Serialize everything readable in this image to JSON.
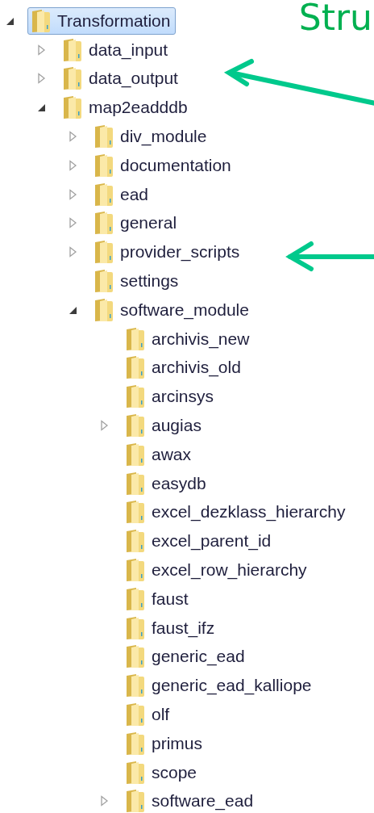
{
  "heading": "Stru",
  "tree": [
    {
      "label": "Transformation",
      "selected": true,
      "expanded": true,
      "children": [
        {
          "label": "data_input",
          "selected": false,
          "expanded": false
        },
        {
          "label": "data_output",
          "selected": false,
          "expanded": false
        },
        {
          "label": "map2eadddb",
          "selected": false,
          "expanded": true,
          "children": [
            {
              "label": "div_module",
              "selected": false,
              "expanded": false
            },
            {
              "label": "documentation",
              "selected": false,
              "expanded": false
            },
            {
              "label": "ead",
              "selected": false,
              "expanded": false
            },
            {
              "label": "general",
              "selected": false,
              "expanded": false
            },
            {
              "label": "provider_scripts",
              "selected": false,
              "expanded": false
            },
            {
              "label": "settings",
              "selected": false
            },
            {
              "label": "software_module",
              "selected": false,
              "expanded": true,
              "children": [
                {
                  "label": "archivis_new",
                  "selected": false
                },
                {
                  "label": "archivis_old",
                  "selected": false
                },
                {
                  "label": "arcinsys",
                  "selected": false
                },
                {
                  "label": "augias",
                  "selected": false,
                  "expanded": false
                },
                {
                  "label": "awax",
                  "selected": false
                },
                {
                  "label": "easydb",
                  "selected": false
                },
                {
                  "label": "excel_dezklass_hierarchy",
                  "selected": false
                },
                {
                  "label": "excel_parent_id",
                  "selected": false
                },
                {
                  "label": "excel_row_hierarchy",
                  "selected": false
                },
                {
                  "label": "faust",
                  "selected": false
                },
                {
                  "label": "faust_ifz",
                  "selected": false
                },
                {
                  "label": "generic_ead",
                  "selected": false
                },
                {
                  "label": "generic_ead_kalliope",
                  "selected": false
                },
                {
                  "label": "olf",
                  "selected": false
                },
                {
                  "label": "primus",
                  "selected": false
                },
                {
                  "label": "scope",
                  "selected": false
                },
                {
                  "label": "software_ead",
                  "selected": false,
                  "expanded": false
                }
              ]
            }
          ]
        }
      ]
    }
  ]
}
